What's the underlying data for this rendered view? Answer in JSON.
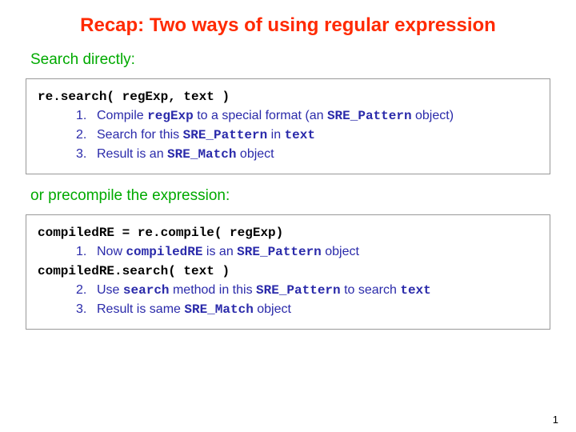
{
  "title": "Recap: Two ways of using regular expression",
  "sub1": "Search directly:",
  "box1": {
    "line1": "re.search( regExp, text )",
    "items": [
      {
        "n": "1.",
        "pre": "Compile ",
        "code1": "regExp",
        "mid": " to a special format (an ",
        "code2": "SRE_Pattern",
        "post": " object)"
      },
      {
        "n": "2.",
        "pre": "Search for this ",
        "code1": "SRE_Pattern",
        "mid": " in ",
        "code2": "text",
        "post": ""
      },
      {
        "n": "3.",
        "pre": "Result is an ",
        "code1": "SRE_Match",
        "mid": " object",
        "code2": "",
        "post": ""
      }
    ]
  },
  "sub2": "or precompile the expression:",
  "box2": {
    "line1": "compiledRE = re.compile( regExp)",
    "item1": {
      "n": "1.",
      "pre": "Now ",
      "code1": "compiledRE",
      "mid": " is an ",
      "code2": "SRE_Pattern",
      "post": " object"
    },
    "line2": "compiledRE.search( text )",
    "item2": {
      "n": "2.",
      "pre": "Use ",
      "code1": "search",
      "mid": " method in this ",
      "code2": "SRE_Pattern",
      "mid2": " to search ",
      "code3": "text"
    },
    "item3": {
      "n": "3.",
      "pre": "Result is same ",
      "code1": "SRE_Match",
      "mid": " object"
    }
  },
  "pagenum": "1"
}
